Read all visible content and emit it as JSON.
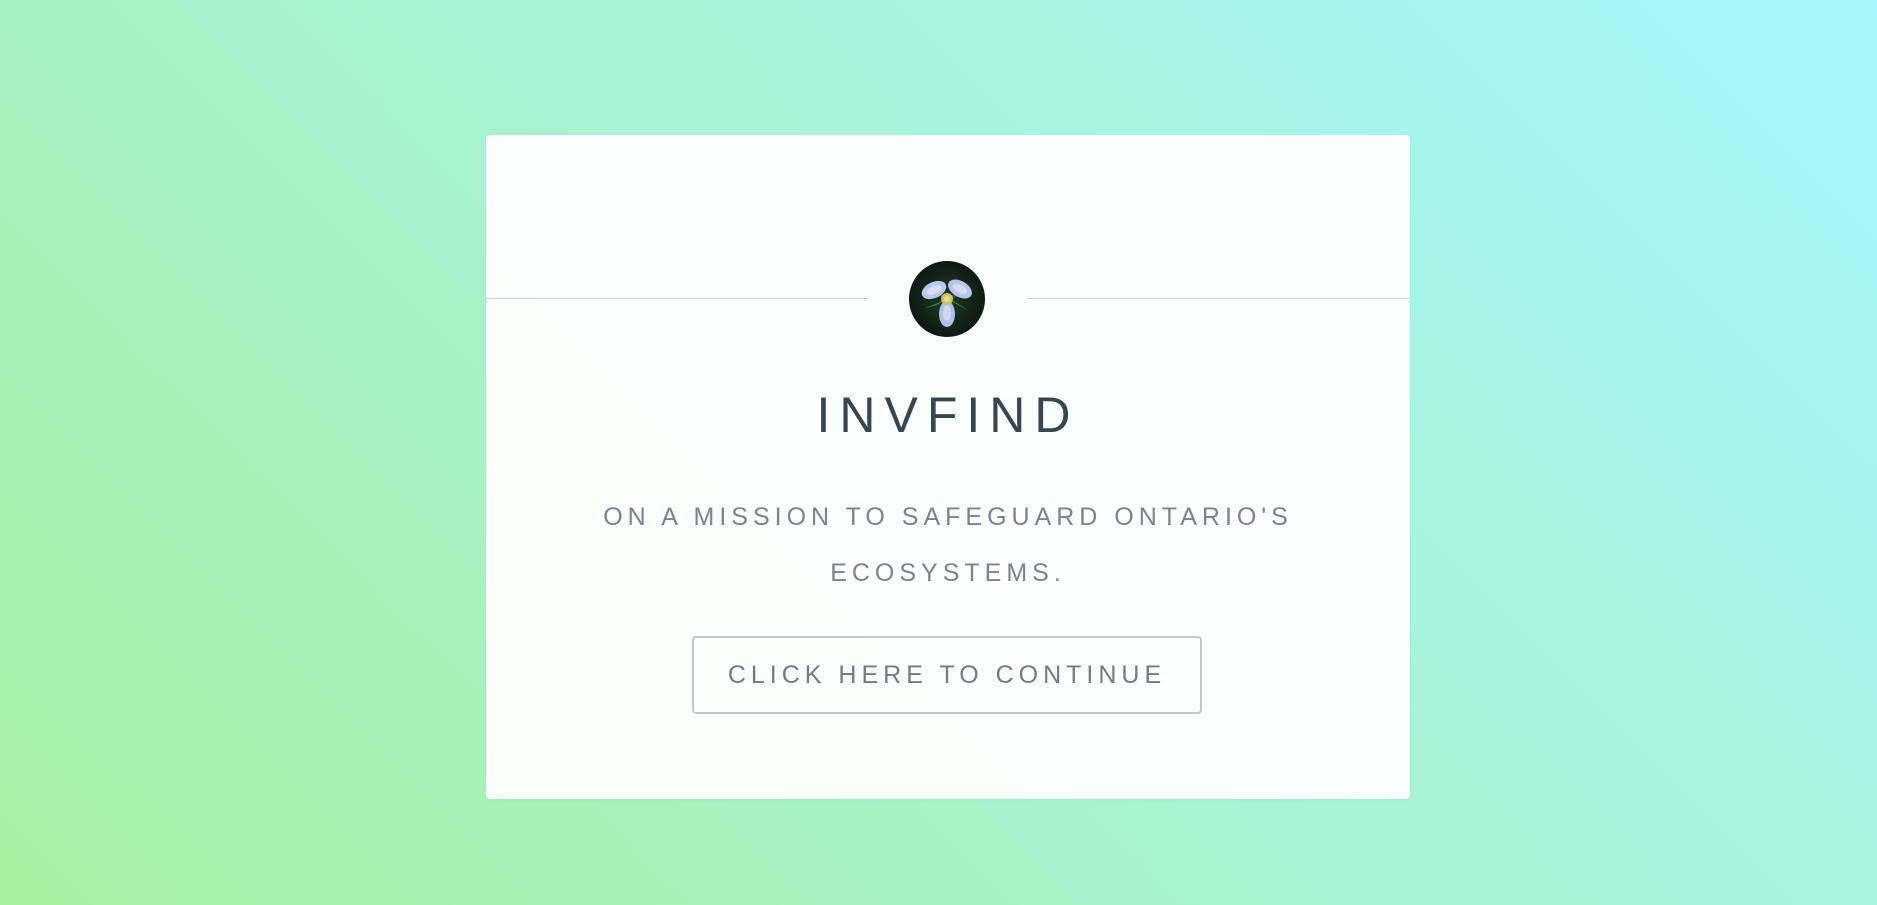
{
  "card": {
    "logo_icon": "trillium-flower-icon",
    "title": "INVFIND",
    "subtitle": "ON A MISSION TO SAFEGUARD ONTARIO'S ECOSYSTEMS.",
    "cta_label": "CLICK HERE TO CONTINUE"
  },
  "colors": {
    "background_gradient": [
      "#a7f0a0",
      "#a7f3d3",
      "#a6f6fb"
    ],
    "card": "#ffffff",
    "title": "#37474f",
    "subtitle": "#78858c",
    "button_border": "#c2c8cb"
  }
}
